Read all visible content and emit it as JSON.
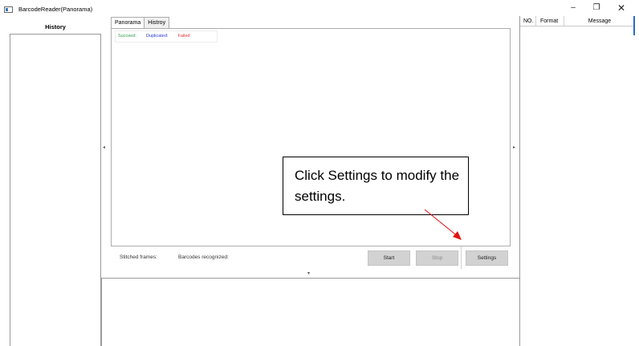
{
  "window": {
    "title": "BarcodeReader(Panorama)",
    "minimize_glyph": "–",
    "restore_glyph": "❐",
    "close_glyph": "✕",
    "icon": "app-window-icon"
  },
  "history": {
    "title": "History"
  },
  "tabs": [
    {
      "label": "Panorama",
      "active": true
    },
    {
      "label": "Histroy",
      "active": false
    }
  ],
  "status": {
    "succeed_label": "Succeed:",
    "duplicated_label": "Duplicated:",
    "failed_label": "Failed:",
    "colors": {
      "succeed": "#2ea04a",
      "duplicated": "#2b3bd0",
      "failed": "#e03a3a"
    }
  },
  "nav": {
    "left_arrow": "◂",
    "right_arrow": "▸",
    "down_arrow": "▾"
  },
  "callout": {
    "text": "Click Settings to modify the settings.",
    "arrow_color": "#e01010"
  },
  "bottom_bar": {
    "stitched_label": "Stitched frames:",
    "barcodes_label": "Barcodes recognized:",
    "start_label": "Start",
    "stop_label": "Stop",
    "settings_label": "Settings"
  },
  "results_table": {
    "columns": [
      "NO.",
      "Format",
      "Message"
    ]
  }
}
